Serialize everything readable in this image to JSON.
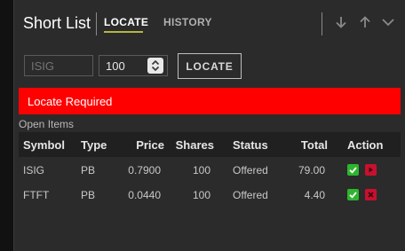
{
  "header": {
    "title": "Short List",
    "tabs": [
      {
        "label": "LOCATE",
        "active": true
      },
      {
        "label": "HISTORY",
        "active": false
      }
    ],
    "icons": [
      "arrow-down-icon",
      "arrow-up-icon",
      "chevron-down-icon"
    ]
  },
  "form": {
    "symbol_placeholder": "ISIG",
    "quantity_value": "100",
    "locate_button_label": "LOCATE"
  },
  "alert": {
    "text": "Locate Required",
    "color": "#ff0000"
  },
  "open_items": {
    "label": "Open Items",
    "columns": [
      "Symbol",
      "Type",
      "Price",
      "Shares",
      "Status",
      "Total",
      "Action"
    ],
    "rows": [
      {
        "symbol": "ISIG",
        "type": "PB",
        "price": "0.7900",
        "shares": "100",
        "status": "Offered",
        "total": "79.00"
      },
      {
        "symbol": "FTFT",
        "type": "PB",
        "price": "0.0440",
        "shares": "100",
        "status": "Offered",
        "total": "4.40"
      }
    ]
  },
  "colors": {
    "accept": "#2db52d",
    "reject_row1": "#c8102e",
    "reject_row2": "#c8102e",
    "tab_underline": "#b5b542"
  }
}
